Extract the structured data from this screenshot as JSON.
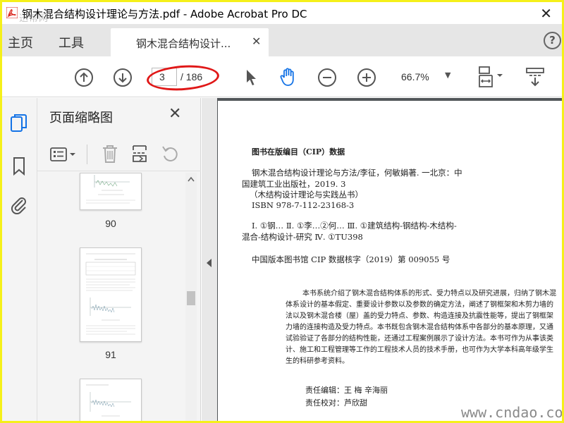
{
  "window": {
    "title": "钢木混合结构设计理论与方法.pdf - Adobe Acrobat Pro DC",
    "close_glyph": "✕",
    "overlay_logo": "迅帮网"
  },
  "tabs": {
    "home": "主页",
    "tools": "工具",
    "document": "钢木混合结构设计...",
    "document_close": "✕",
    "help": "?"
  },
  "toolbar": {
    "current_page": "3",
    "total_pages": "/ 186",
    "zoom": "66.7%",
    "zoom_caret": "▼"
  },
  "thumbnail_panel": {
    "title": "页面缩略图",
    "close": "✕",
    "thumbnails": [
      {
        "label": "90"
      },
      {
        "label": "91"
      }
    ]
  },
  "document_page": {
    "cip_heading": "图书在版编目（CIP）数据",
    "cip_line1": "钢木混合结构设计理论与方法/李征，何敏娟著. 一北京：中",
    "cip_line2": "国建筑工业出版社，2019. 3",
    "cip_line3": "（木结构设计理论与实践丛书）",
    "cip_line4": "ISBN 978-7-112-23168-3",
    "cip_line5": "Ⅰ. ①钢…   Ⅱ. ①李…②何…   Ⅲ. ①建筑结构-钢结构-木结构-",
    "cip_line6": "混合-结构设计-研究   Ⅳ. ①TU398",
    "cip_core": "中国版本图书馆 CIP 数据核字（2019）第 009055 号",
    "summary": [
      "本书系统介绍了钢木混合结构体系的形式、受力特点以及研究进展，归纳了钢木混",
      "体系设计的基本假定、重要设计参数以及参数的确定方法，阐述了钢框架和木剪力墙的",
      "法以及钢木混合楼（屋）盖的受力特点、参数、构造连接及抗震性能等，提出了钢框架",
      "力墙的连接构造及受力特点。本书既包含钢木混合结构体系中各部分的基本原理，又通",
      "试验验证了各部分的结构性能，还通过工程案例展示了设计方法。本书可作为从事该类",
      "计、施工和工程管理等工作的工程技术人员的技术手册，也可作为大学本科高年级学生",
      "生的科研参考资料。"
    ],
    "editor": "责任编辑：王   梅   辛海丽",
    "proofreader": "责任校对：芦欣甜"
  },
  "site_watermark": "www.cndao.com",
  "colors": {
    "frame_border": "#f5f01a",
    "annotation_red": "#e01818",
    "acrobat_red": "#d9241c",
    "icon_gray": "#555555",
    "active_blue": "#1473e6"
  }
}
